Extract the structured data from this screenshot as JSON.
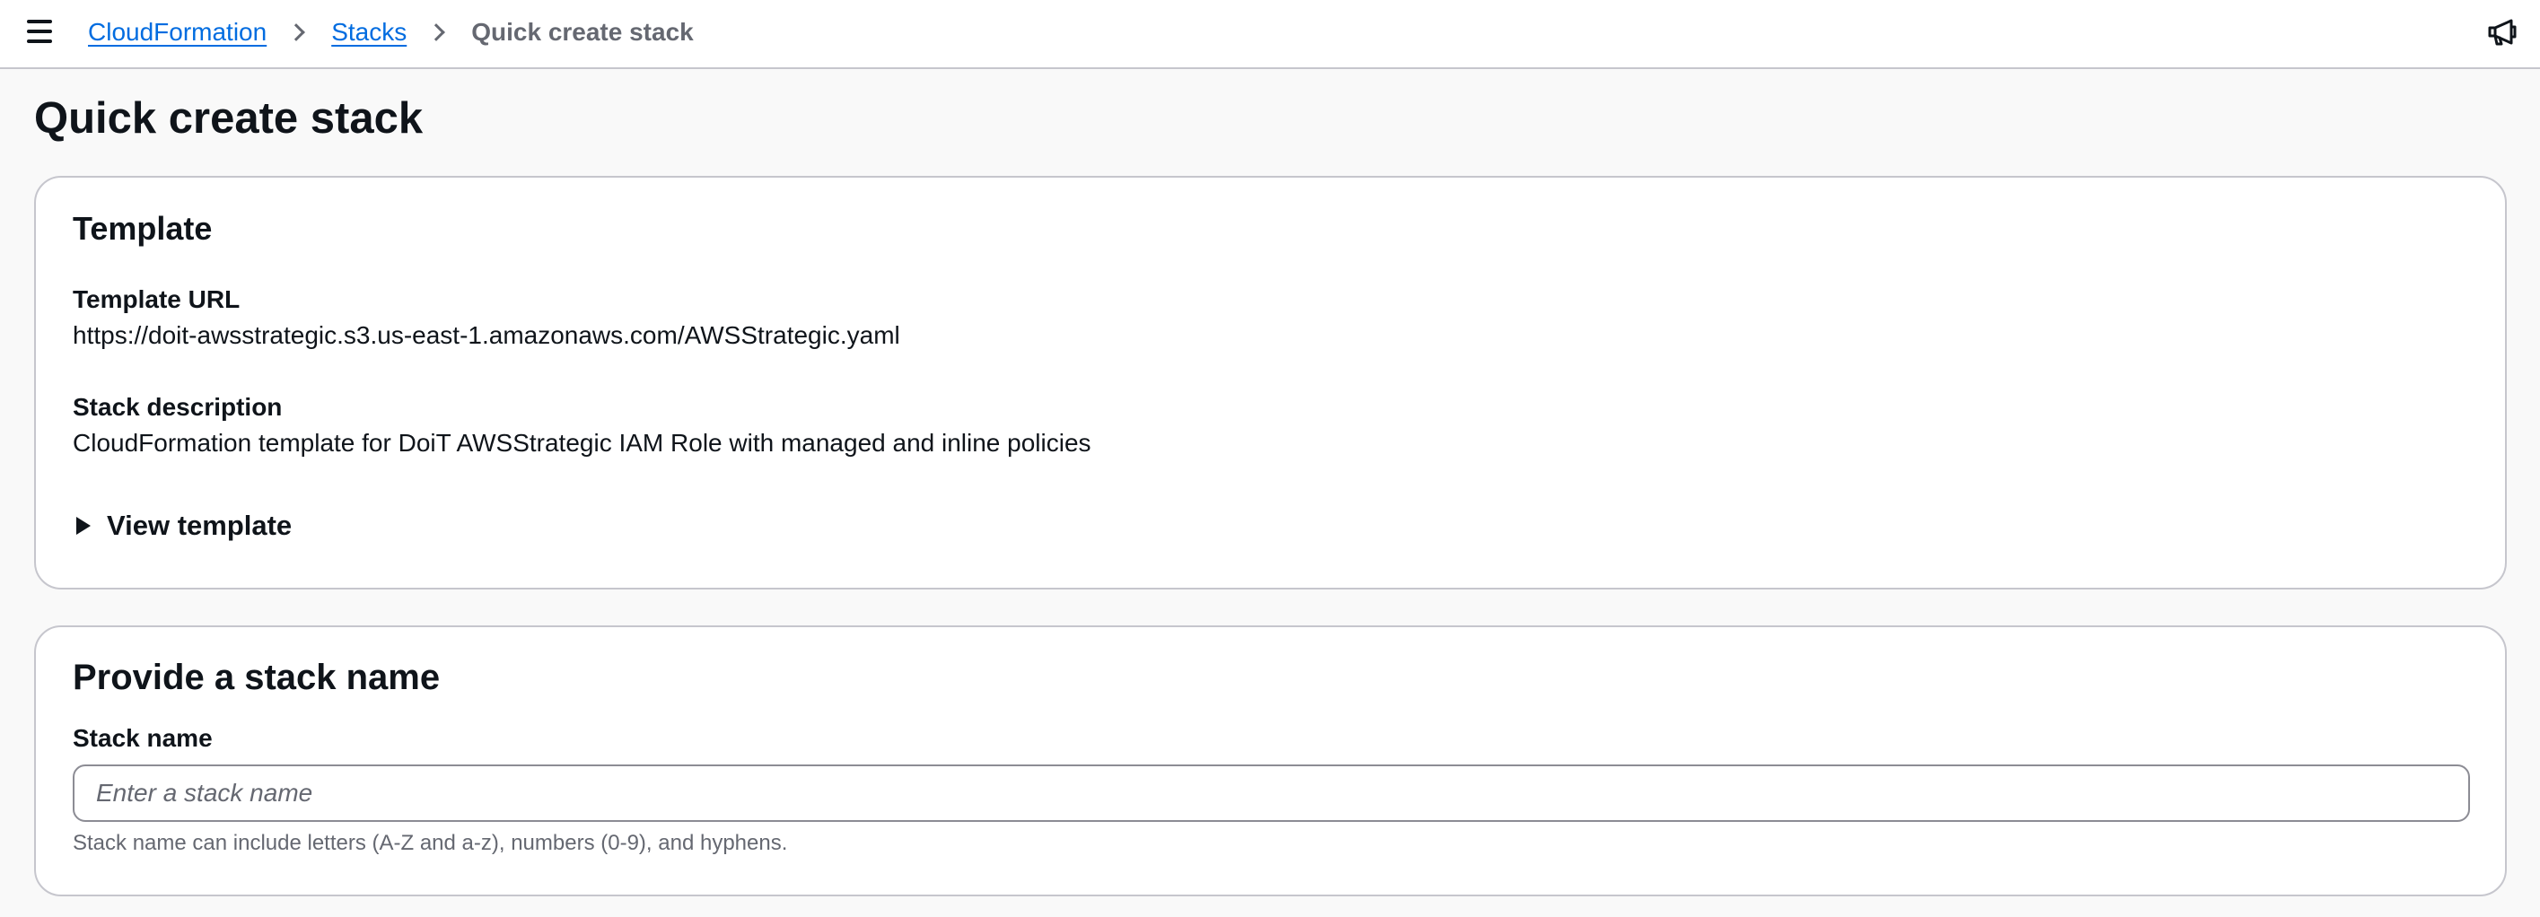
{
  "breadcrumb": {
    "items": [
      {
        "label": "CloudFormation"
      },
      {
        "label": "Stacks"
      }
    ],
    "current": "Quick create stack"
  },
  "page": {
    "title": "Quick create stack"
  },
  "template_section": {
    "heading": "Template",
    "url_label": "Template URL",
    "url_value": "https://doit-awsstrategic.s3.us-east-1.amazonaws.com/AWSStrategic.yaml",
    "description_label": "Stack description",
    "description_value": "CloudFormation template for DoiT AWSStrategic IAM Role with managed and inline policies",
    "view_template_label": "View template"
  },
  "stack_name_section": {
    "heading": "Provide a stack name",
    "field_label": "Stack name",
    "input_value": "",
    "input_placeholder": "Enter a stack name",
    "constraint": "Stack name can include letters (A-Z and a-z), numbers (0-9), and hyphens."
  },
  "icons": {
    "menu": "hamburger-menu-icon",
    "breadcrumb_separator": "chevron-right-icon",
    "announcements": "megaphone-icon",
    "expander": "caret-right-icon"
  },
  "colors": {
    "link": "#006ce0",
    "text": "#0f141a",
    "secondary_text": "#656871",
    "border": "#c6c6cd",
    "page_background": "#f9f9f9"
  }
}
